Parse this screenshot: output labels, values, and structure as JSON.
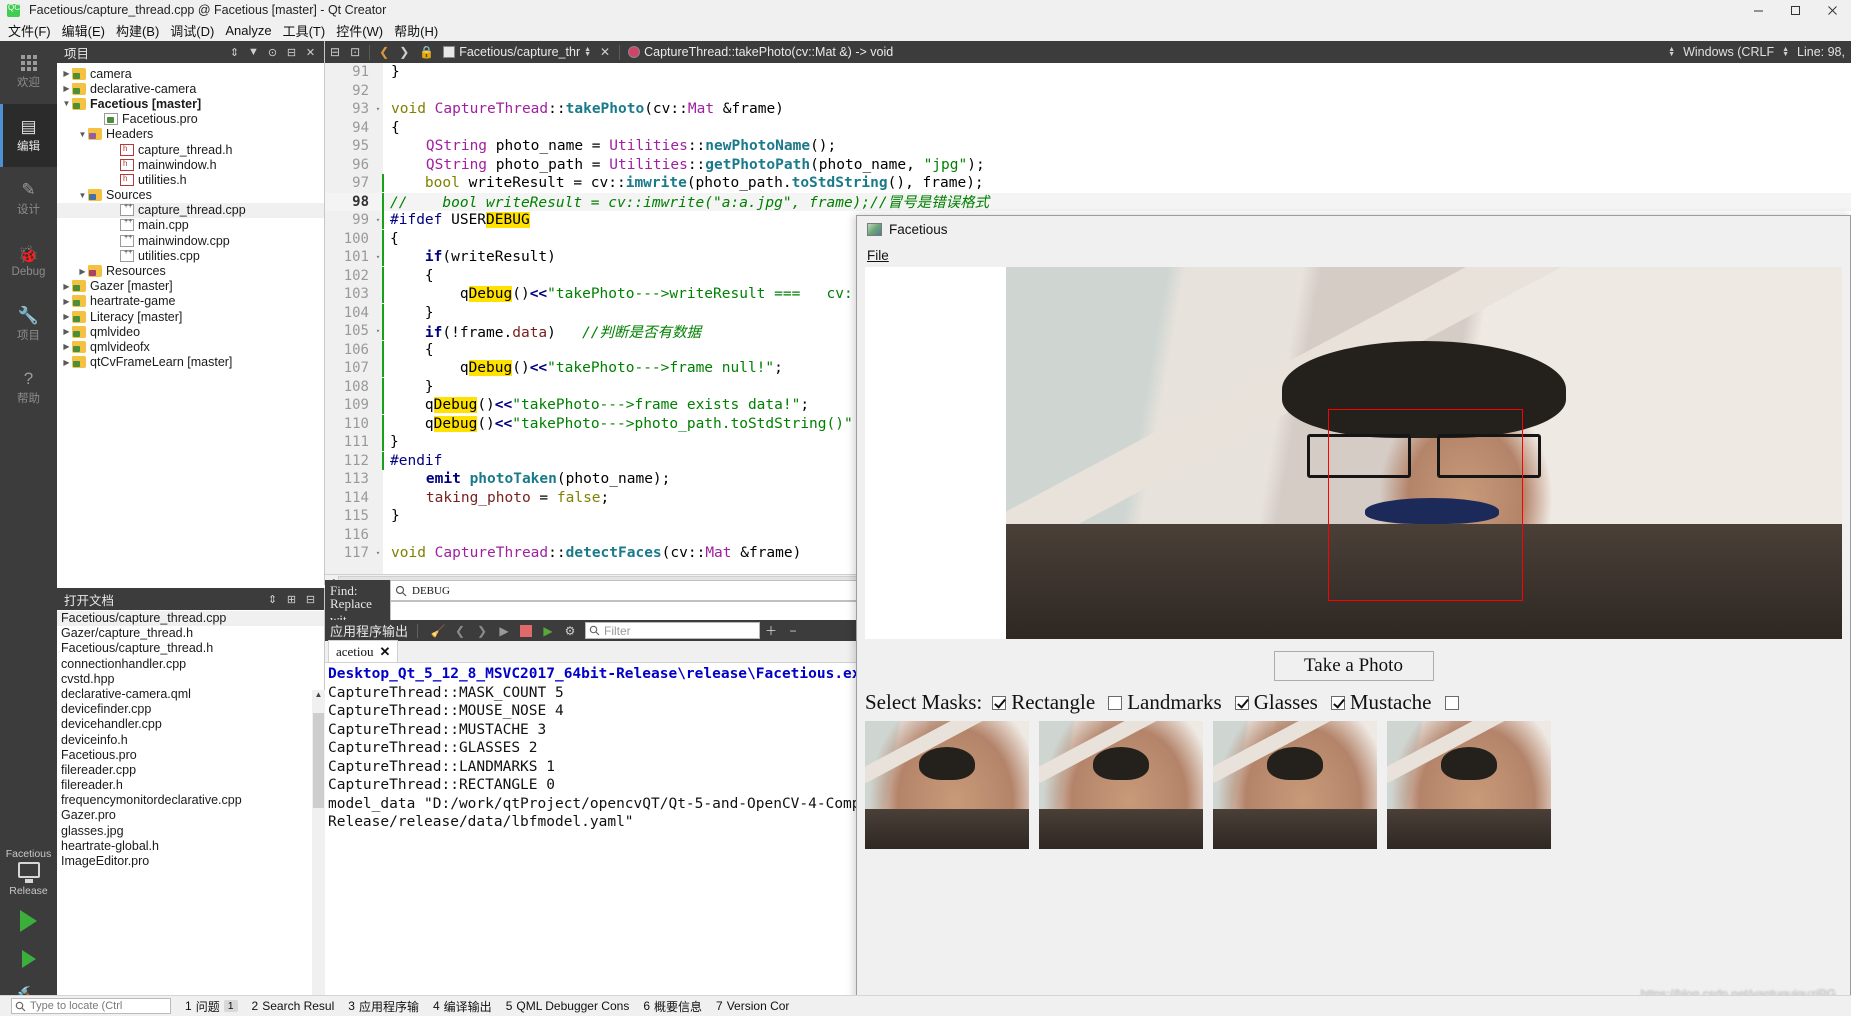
{
  "titlebar": {
    "title": "Facetious/capture_thread.cpp @ Facetious [master] - Qt Creator",
    "icon": "qt-creator-icon",
    "minimize": "minimize-icon",
    "maximize": "maximize-icon",
    "close": "close-icon"
  },
  "menubar": {
    "items": [
      {
        "label": "文件(F)"
      },
      {
        "label": "编辑(E)"
      },
      {
        "label": "构建(B)"
      },
      {
        "label": "调试(D)"
      },
      {
        "label": "Analyze"
      },
      {
        "label": "工具(T)"
      },
      {
        "label": "控件(W)"
      },
      {
        "label": "帮助(H)"
      }
    ]
  },
  "modebar": {
    "items": [
      {
        "label": "欢迎",
        "icon": "grid-icon",
        "active": false
      },
      {
        "label": "编辑",
        "icon": "edit-icon",
        "active": true
      },
      {
        "label": "设计",
        "icon": "design-pencil-icon",
        "active": false
      },
      {
        "label": "Debug",
        "icon": "bug-icon",
        "active": false
      },
      {
        "label": "项目",
        "icon": "wrench-icon",
        "active": false
      },
      {
        "label": "帮助",
        "icon": "question-icon",
        "active": false
      }
    ],
    "kit": {
      "project": "Facetious",
      "build_config": "Release",
      "run_icon": "run-triangle-icon",
      "debug_icon": "run-debug-icon",
      "build_icon": "hammer-icon"
    }
  },
  "project_panel": {
    "title": "项目",
    "sort_icon": "sort-icon",
    "filter_icon": "filter-icon",
    "link_icon": "link-with-editor-icon",
    "split_icon": "split-icon",
    "close_icon": "close-icon",
    "tree": [
      {
        "label": "camera",
        "depth": 1,
        "arrow": "right",
        "icon": "folder-qt",
        "bold": false,
        "selected": false
      },
      {
        "label": "declarative-camera",
        "depth": 1,
        "arrow": "right",
        "icon": "folder-qt",
        "bold": false,
        "selected": false
      },
      {
        "label": "Facetious [master]",
        "depth": 1,
        "arrow": "down",
        "icon": "folder-qt",
        "bold": true,
        "selected": false
      },
      {
        "label": "Facetious.pro",
        "depth": 3,
        "arrow": "none",
        "icon": "file-pro",
        "bold": false,
        "selected": false
      },
      {
        "label": "Headers",
        "depth": 2,
        "arrow": "down",
        "icon": "folder-h",
        "bold": false,
        "selected": false
      },
      {
        "label": "capture_thread.h",
        "depth": 4,
        "arrow": "none",
        "icon": "file-h",
        "bold": false,
        "selected": false
      },
      {
        "label": "mainwindow.h",
        "depth": 4,
        "arrow": "none",
        "icon": "file-h",
        "bold": false,
        "selected": false
      },
      {
        "label": "utilities.h",
        "depth": 4,
        "arrow": "none",
        "icon": "file-h",
        "bold": false,
        "selected": false
      },
      {
        "label": "Sources",
        "depth": 2,
        "arrow": "down",
        "icon": "folder-cpp",
        "bold": false,
        "selected": false
      },
      {
        "label": "capture_thread.cpp",
        "depth": 4,
        "arrow": "none",
        "icon": "file-cpp",
        "bold": false,
        "selected": true
      },
      {
        "label": "main.cpp",
        "depth": 4,
        "arrow": "none",
        "icon": "file-cpp",
        "bold": false,
        "selected": false
      },
      {
        "label": "mainwindow.cpp",
        "depth": 4,
        "arrow": "none",
        "icon": "file-cpp",
        "bold": false,
        "selected": false
      },
      {
        "label": "utilities.cpp",
        "depth": 4,
        "arrow": "none",
        "icon": "file-cpp",
        "bold": false,
        "selected": false
      },
      {
        "label": "Resources",
        "depth": 2,
        "arrow": "right",
        "icon": "folder-res",
        "bold": false,
        "selected": false
      },
      {
        "label": "Gazer [master]",
        "depth": 1,
        "arrow": "right",
        "icon": "folder-qt",
        "bold": false,
        "selected": false
      },
      {
        "label": "heartrate-game",
        "depth": 1,
        "arrow": "right",
        "icon": "folder-qt",
        "bold": false,
        "selected": false
      },
      {
        "label": "Literacy [master]",
        "depth": 1,
        "arrow": "right",
        "icon": "folder-qt",
        "bold": false,
        "selected": false
      },
      {
        "label": "qmlvideo",
        "depth": 1,
        "arrow": "right",
        "icon": "folder-qt",
        "bold": false,
        "selected": false
      },
      {
        "label": "qmlvideofx",
        "depth": 1,
        "arrow": "right",
        "icon": "folder-qt",
        "bold": false,
        "selected": false
      },
      {
        "label": "qtCvFrameLearn [master]",
        "depth": 1,
        "arrow": "right",
        "icon": "folder-qt",
        "bold": false,
        "selected": false
      }
    ]
  },
  "open_documents": {
    "title": "打开文档",
    "sort_icon": "sort-icon",
    "split_icon": "split-icon",
    "close_icon": "close-icon",
    "items": [
      {
        "label": "Facetious/capture_thread.cpp",
        "selected": true
      },
      {
        "label": "Gazer/capture_thread.h",
        "selected": false
      },
      {
        "label": "Facetious/capture_thread.h",
        "selected": false
      },
      {
        "label": "connectionhandler.cpp",
        "selected": false
      },
      {
        "label": "cvstd.hpp",
        "selected": false
      },
      {
        "label": "declarative-camera.qml",
        "selected": false
      },
      {
        "label": "devicefinder.cpp",
        "selected": false
      },
      {
        "label": "devicehandler.cpp",
        "selected": false
      },
      {
        "label": "deviceinfo.h",
        "selected": false
      },
      {
        "label": "Facetious.pro",
        "selected": false
      },
      {
        "label": "filereader.cpp",
        "selected": false
      },
      {
        "label": "filereader.h",
        "selected": false
      },
      {
        "label": "frequencymonitordeclarative.cpp",
        "selected": false
      },
      {
        "label": "Gazer.pro",
        "selected": false
      },
      {
        "label": "glasses.jpg",
        "selected": false
      },
      {
        "label": "heartrate-global.h",
        "selected": false
      },
      {
        "label": "ImageEditor.pro",
        "selected": false
      }
    ]
  },
  "editor_toolbar": {
    "split_icon": "split-horizontal-icon",
    "close_split_icon": "close-split-icon",
    "back_icon": "nav-back-icon",
    "forward_icon": "nav-forward-icon",
    "lock_icon": "lock-icon",
    "file_selector": "Facetious/capture_thr",
    "file_close_icon": "close-icon",
    "symbol_selector": "CaptureThread::takePhoto(cv::Mat &) -> void",
    "symbol_icon": "method-icon",
    "line_ending": "Windows (CRLF",
    "line_label": "Line: 98,",
    "split_right_icon": "split-icon",
    "close_right_icon": "close-icon"
  },
  "code": {
    "lines": [
      {
        "num": "91",
        "fold": "",
        "current": false,
        "mark": false,
        "html": "<span class=\"txt\">}</span>"
      },
      {
        "num": "92",
        "fold": "",
        "current": false,
        "mark": false,
        "html": "<span class=\"txt\"></span>"
      },
      {
        "num": "93",
        "fold": "▾",
        "current": false,
        "mark": false,
        "html": "<span class=\"txt\"><span class=\"kw\">void</span> <span class=\"cls\">CaptureThread</span>::<span class=\"fn\">takePhoto</span>(cv::<span class=\"cls\">Mat</span> &amp;frame)</span>"
      },
      {
        "num": "94",
        "fold": "",
        "current": false,
        "mark": false,
        "html": "<span class=\"txt\">{</span>"
      },
      {
        "num": "95",
        "fold": "",
        "current": false,
        "mark": false,
        "html": "<span class=\"txt\">    <span class=\"cls\">QString</span> photo_name = <span class=\"cls\">Utilities</span>::<span class=\"fn\">newPhotoName</span>();</span>"
      },
      {
        "num": "96",
        "fold": "",
        "current": false,
        "mark": false,
        "html": "<span class=\"txt\">    <span class=\"cls\">QString</span> photo_path = <span class=\"cls\">Utilities</span>::<span class=\"fn\">getPhotoPath</span>(photo_name, <span class=\"str\">\"jpg\"</span>);</span>"
      },
      {
        "num": "97",
        "fold": "",
        "current": false,
        "mark": true,
        "html": "<span class=\"txt\">    <span class=\"kw\">bool</span> writeResult = cv::<span class=\"fn\">imwrite</span>(photo_path.<span class=\"fn\">toStdString</span>(), frame);</span>"
      },
      {
        "num": "98",
        "fold": "",
        "current": true,
        "mark": true,
        "html": "<span class=\"txt\"><span class=\"cmt\">//    bool writeResult = cv::imwrite(\"a:a.jpg\", frame);//冒号是错误格式</span></span>"
      },
      {
        "num": "99",
        "fold": "▾",
        "current": false,
        "mark": true,
        "html": "<span class=\"txt\"><span class=\"pp\">#ifdef</span> USER<span class=\"hl\">DEBUG</span></span>"
      },
      {
        "num": "100",
        "fold": "",
        "current": false,
        "mark": true,
        "html": "<span class=\"txt\">{</span>"
      },
      {
        "num": "101",
        "fold": "▾",
        "current": false,
        "mark": true,
        "html": "<span class=\"txt\">    <span class=\"kw2\">if</span>(writeResult)</span>"
      },
      {
        "num": "102",
        "fold": "",
        "current": false,
        "mark": true,
        "html": "<span class=\"txt\">    {</span>"
      },
      {
        "num": "103",
        "fold": "",
        "current": false,
        "mark": true,
        "html": "<span class=\"txt\">        q<span class=\"hl\">Debug</span>()<span class=\"kw2\">&lt;&lt;</span><span class=\"str\">\"takePhoto---&gt;writeResult ===   cv:</span></span>"
      },
      {
        "num": "104",
        "fold": "",
        "current": false,
        "mark": true,
        "html": "<span class=\"txt\">    }</span>"
      },
      {
        "num": "105",
        "fold": "▾",
        "current": false,
        "mark": true,
        "html": "<span class=\"txt\">    <span class=\"kw2\">if</span>(!frame.<span class=\"var\">data</span>)   <span class=\"cmt\">//判断是否有数据</span></span>"
      },
      {
        "num": "106",
        "fold": "",
        "current": false,
        "mark": true,
        "html": "<span class=\"txt\">    {</span>"
      },
      {
        "num": "107",
        "fold": "",
        "current": false,
        "mark": true,
        "html": "<span class=\"txt\">        q<span class=\"hl\">Debug</span>()<span class=\"kw2\">&lt;&lt;</span><span class=\"str\">\"takePhoto---&gt;frame null!\"</span>;</span>"
      },
      {
        "num": "108",
        "fold": "",
        "current": false,
        "mark": true,
        "html": "<span class=\"txt\">    }</span>"
      },
      {
        "num": "109",
        "fold": "",
        "current": false,
        "mark": true,
        "html": "<span class=\"txt\">    q<span class=\"hl\">Debug</span>()<span class=\"kw2\">&lt;&lt;</span><span class=\"str\">\"takePhoto---&gt;frame exists data!\"</span>;</span>"
      },
      {
        "num": "110",
        "fold": "",
        "current": false,
        "mark": true,
        "html": "<span class=\"txt\">    q<span class=\"hl\">Debug</span>()<span class=\"kw2\">&lt;&lt;</span><span class=\"str\">\"takePhoto---&gt;photo_path.toStdString()\"</span></span>"
      },
      {
        "num": "111",
        "fold": "",
        "current": false,
        "mark": true,
        "html": "<span class=\"txt\">}</span>"
      },
      {
        "num": "112",
        "fold": "",
        "current": false,
        "mark": true,
        "html": "<span class=\"txt\"><span class=\"pp\">#endif</span></span>"
      },
      {
        "num": "113",
        "fold": "",
        "current": false,
        "mark": false,
        "html": "<span class=\"txt\">    <span class=\"kw2\">emit</span> <span class=\"fn\">photoTaken</span>(photo_name);</span>"
      },
      {
        "num": "114",
        "fold": "",
        "current": false,
        "mark": false,
        "html": "<span class=\"txt\">    <span class=\"var\">taking_photo</span> = <span class=\"kw\">false</span>;</span>"
      },
      {
        "num": "115",
        "fold": "",
        "current": false,
        "mark": false,
        "html": "<span class=\"txt\">}</span>"
      },
      {
        "num": "116",
        "fold": "",
        "current": false,
        "mark": false,
        "html": "<span class=\"txt\"></span>"
      },
      {
        "num": "117",
        "fold": "▾",
        "current": false,
        "mark": false,
        "html": "<span class=\"txt\"><span class=\"kw\">void</span> <span class=\"cls\">CaptureThread</span>::<span class=\"fn\">detectFaces</span>(cv::<span class=\"cls\">Mat</span> &amp;frame)</span>"
      }
    ]
  },
  "find": {
    "find_label": "Find:",
    "find_value": "DEBUG",
    "find_icon": "search-icon",
    "replace_label": "Replace wit",
    "replace_value": ""
  },
  "output": {
    "title": "应用程序输出",
    "clear_icon": "clear-icon",
    "prev_icon": "prev-icon",
    "next_icon": "next-icon",
    "run_icon": "run-icon",
    "stop_icon": "stop-icon",
    "rerun_icon": "rerun-icon",
    "settings_icon": "gear-icon",
    "filter_placeholder": "Filter",
    "filter_search_icon": "search-icon",
    "zoom_in_icon": "plus-icon",
    "zoom_out_icon": "minus-icon",
    "tab_label": "acetiou",
    "tab_close_icon": "close-icon",
    "lines": [
      {
        "text": "Desktop_Qt_5_12_8_MSVC2017_64bit-Release\\release\\Facetious.ex",
        "highlight": true
      },
      {
        "text": "CaptureThread::MASK_COUNT 5",
        "highlight": false
      },
      {
        "text": "CaptureThread::MOUSE_NOSE 4",
        "highlight": false
      },
      {
        "text": "CaptureThread::MUSTACHE 3",
        "highlight": false
      },
      {
        "text": "CaptureThread::GLASSES 2",
        "highlight": false
      },
      {
        "text": "CaptureThread::LANDMARKS 1",
        "highlight": false
      },
      {
        "text": "CaptureThread::RECTANGLE 0",
        "highlight": false
      },
      {
        "text": "model_data \"D:/work/qtProject/opencvQT/Qt-5-and-OpenCV-4-Comp",
        "highlight": false
      },
      {
        "text": "Release/release/data/lbfmodel.yaml\"",
        "highlight": false
      }
    ]
  },
  "statusbar": {
    "locate_icon": "search-icon",
    "locate_placeholder": "Type to locate (Ctrl",
    "items": [
      {
        "num": "1",
        "label": "问题",
        "badge": "1"
      },
      {
        "num": "2",
        "label": "Search Resul",
        "badge": ""
      },
      {
        "num": "3",
        "label": "应用程序输",
        "badge": ""
      },
      {
        "num": "4",
        "label": "编译输出",
        "badge": ""
      },
      {
        "num": "5",
        "label": "QML Debugger Cons",
        "badge": ""
      },
      {
        "num": "6",
        "label": "概要信息",
        "badge": ""
      },
      {
        "num": "7",
        "label": "Version Cor",
        "badge": ""
      }
    ]
  },
  "app_window": {
    "title": "Facetious",
    "icon": "app-icon",
    "menu": [
      {
        "label": "File"
      }
    ],
    "take_photo_button": "Take a Photo",
    "masks_label": "Select Masks:",
    "masks": [
      {
        "label": "Rectangle",
        "checked": true
      },
      {
        "label": "Landmarks",
        "checked": false
      },
      {
        "label": "Glasses",
        "checked": true
      },
      {
        "label": "Mustache",
        "checked": true
      }
    ],
    "watermark": "https://blog.csdn.net/yantuguiguziPG",
    "thumbnails": [
      {
        "name": "thumbnail-1"
      },
      {
        "name": "thumbnail-2"
      },
      {
        "name": "thumbnail-3"
      },
      {
        "name": "thumbnail-4"
      }
    ]
  }
}
